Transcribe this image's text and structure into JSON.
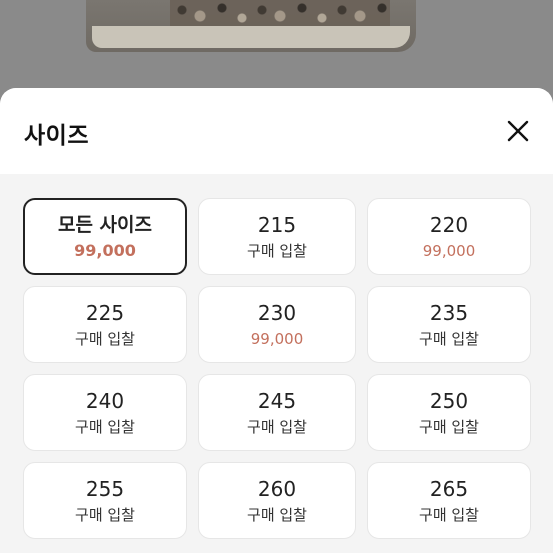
{
  "sheet": {
    "title": "사이즈",
    "close_icon": "close-icon"
  },
  "colors": {
    "price": "#c3705d",
    "selected_border": "#222222"
  },
  "sizes": [
    {
      "label": "모든 사이즈",
      "sub": "99,000",
      "sub_type": "price",
      "selected": true
    },
    {
      "label": "215",
      "sub": "구매 입찰",
      "sub_type": "bid",
      "selected": false
    },
    {
      "label": "220",
      "sub": "99,000",
      "sub_type": "price",
      "selected": false
    },
    {
      "label": "225",
      "sub": "구매 입찰",
      "sub_type": "bid",
      "selected": false
    },
    {
      "label": "230",
      "sub": "99,000",
      "sub_type": "price",
      "selected": false
    },
    {
      "label": "235",
      "sub": "구매 입찰",
      "sub_type": "bid",
      "selected": false
    },
    {
      "label": "240",
      "sub": "구매 입찰",
      "sub_type": "bid",
      "selected": false
    },
    {
      "label": "245",
      "sub": "구매 입찰",
      "sub_type": "bid",
      "selected": false
    },
    {
      "label": "250",
      "sub": "구매 입찰",
      "sub_type": "bid",
      "selected": false
    },
    {
      "label": "255",
      "sub": "구매 입찰",
      "sub_type": "bid",
      "selected": false
    },
    {
      "label": "260",
      "sub": "구매 입찰",
      "sub_type": "bid",
      "selected": false
    },
    {
      "label": "265",
      "sub": "구매 입찰",
      "sub_type": "bid",
      "selected": false
    }
  ]
}
